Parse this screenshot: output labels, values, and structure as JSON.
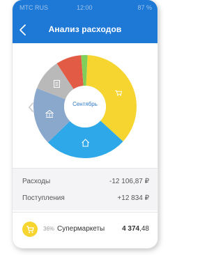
{
  "header": {
    "status_carrier": "МТС RUS",
    "status_time": "12:00",
    "status_battery": "87 %",
    "title": "Анализ расходов",
    "background": "#1e78d6"
  },
  "chart": {
    "center_label": "Сентябрь",
    "segments": [
      {
        "color": "#f7d531",
        "percent": 36,
        "icon": "cart-icon"
      },
      {
        "color": "#2ea8e8",
        "percent": 26,
        "icon": "house-icon"
      },
      {
        "color": "#8aa7cc",
        "percent": 18,
        "icon": "bank-icon"
      },
      {
        "color": "#b9b9b9",
        "percent": 10,
        "icon": "document-icon"
      },
      {
        "color": "#e25b45",
        "percent": 8,
        "icon": ""
      },
      {
        "color": "#7fcf5a",
        "percent": 2,
        "icon": ""
      }
    ]
  },
  "summary": {
    "expenses_label": "Расходы",
    "expenses_value": "-12 106,87 ₽",
    "income_label": "Поступления",
    "income_value": "+12 834 ₽"
  },
  "category": {
    "percent": "36%",
    "name": "Супермаркеты",
    "amount_main": "4 374",
    "amount_cents": ",48"
  }
}
